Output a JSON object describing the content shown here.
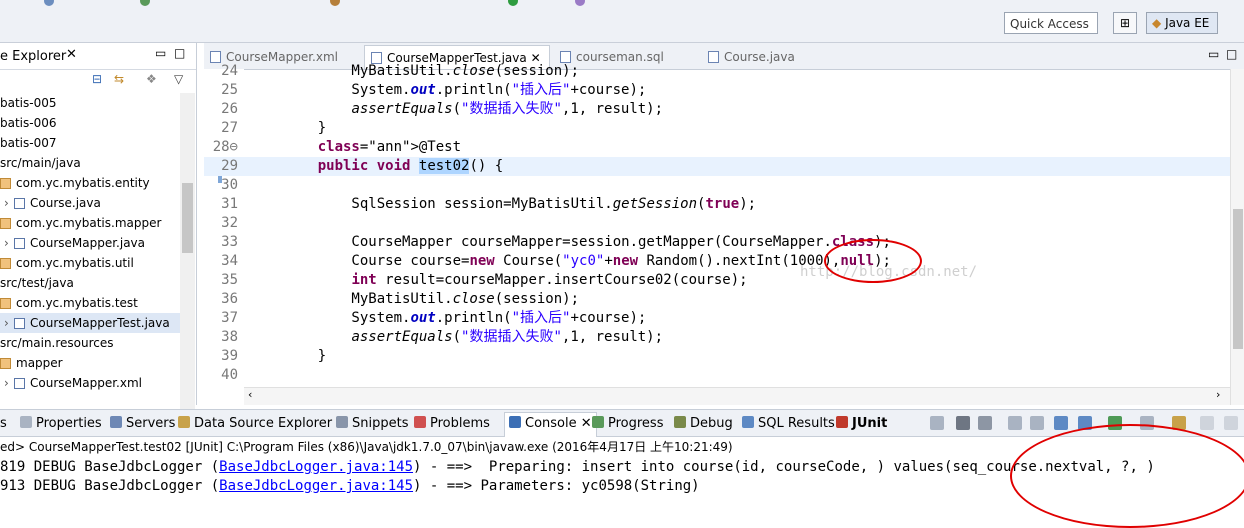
{
  "toolbar": {
    "quick_access_placeholder": "Quick Access",
    "perspective_label": "Java EE"
  },
  "explorer": {
    "title": "e Explorer",
    "items": [
      {
        "label": "batis-005",
        "type": "project"
      },
      {
        "label": "batis-006",
        "type": "project"
      },
      {
        "label": "batis-007",
        "type": "project"
      },
      {
        "label": "src/main/java",
        "type": "srcfolder"
      },
      {
        "label": "com.yc.mybatis.entity",
        "type": "package"
      },
      {
        "label": "Course.java",
        "type": "file"
      },
      {
        "label": "com.yc.mybatis.mapper",
        "type": "package"
      },
      {
        "label": "CourseMapper.java",
        "type": "file"
      },
      {
        "label": "com.yc.mybatis.util",
        "type": "package"
      },
      {
        "label": "src/test/java",
        "type": "srcfolder"
      },
      {
        "label": "com.yc.mybatis.test",
        "type": "package"
      },
      {
        "label": "CourseMapperTest.java",
        "type": "file",
        "selected": true
      },
      {
        "label": "src/main.resources",
        "type": "srcfolder"
      },
      {
        "label": "mapper",
        "type": "package"
      },
      {
        "label": "CourseMapper.xml",
        "type": "file"
      }
    ]
  },
  "editor": {
    "tabs": [
      {
        "label": "CourseMapper.xml",
        "active": false
      },
      {
        "label": "CourseMapperTest.java",
        "active": true
      },
      {
        "label": "courseman.sql",
        "active": false
      },
      {
        "label": "Course.java",
        "active": false
      }
    ],
    "watermark": "http://blog.csdn.net/",
    "lines": [
      {
        "n": "24",
        "t": "        MyBatisUtil.close(session);"
      },
      {
        "n": "25",
        "t": "        System.out.println(\"插入后\"+course);"
      },
      {
        "n": "26",
        "t": "        assertEquals(\"数据插入失败\",1, result);"
      },
      {
        "n": "27",
        "t": "    }"
      },
      {
        "n": "28⊖",
        "t": "    @Test"
      },
      {
        "n": "29",
        "t": "    public void test02() {"
      },
      {
        "n": "30",
        "t": ""
      },
      {
        "n": "31",
        "t": "        SqlSession session=MyBatisUtil.getSession(true);"
      },
      {
        "n": "32",
        "t": ""
      },
      {
        "n": "33",
        "t": "        CourseMapper courseMapper=session.getMapper(CourseMapper.class);"
      },
      {
        "n": "34",
        "t": "        Course course=new Course(\"yc0\"+new Random().nextInt(1000),null);"
      },
      {
        "n": "35",
        "t": "        int result=courseMapper.insertCourse02(course);"
      },
      {
        "n": "36",
        "t": "        MyBatisUtil.close(session);"
      },
      {
        "n": "37",
        "t": "        System.out.println(\"插入后\"+course);"
      },
      {
        "n": "38",
        "t": "        assertEquals(\"数据插入失败\",1, result);"
      },
      {
        "n": "39",
        "t": "    }"
      },
      {
        "n": "40",
        "t": ""
      }
    ]
  },
  "bottom": {
    "tabs": [
      {
        "label": "s",
        "icon": "tasks-icon"
      },
      {
        "label": "Properties",
        "icon": "properties-icon"
      },
      {
        "label": "Servers",
        "icon": "servers-icon"
      },
      {
        "label": "Data Source Explorer",
        "icon": "datasource-icon"
      },
      {
        "label": "Snippets",
        "icon": "snippets-icon"
      },
      {
        "label": "Problems",
        "icon": "problems-icon"
      },
      {
        "label": "Console",
        "icon": "console-icon",
        "active": true
      },
      {
        "label": "Progress",
        "icon": "progress-icon"
      },
      {
        "label": "Debug",
        "icon": "debug-icon"
      },
      {
        "label": "SQL Results",
        "icon": "sql-results-icon"
      },
      {
        "label": "JUnit",
        "icon": "junit-icon"
      }
    ],
    "terminated": "ed> CourseMapperTest.test02 [JUnit] C:\\Program Files (x86)\\Java\\jdk1.7.0_07\\bin\\javaw.exe (2016年4月17日 上午10:21:49)",
    "console_lines": [
      {
        "pre": "819 DEBUG BaseJdbcLogger (",
        "link": "BaseJdbcLogger.java:145",
        "post": ") - ==>  Preparing: insert into course(id, courseCode, ) values(seq_course.nextval, ?, )"
      },
      {
        "pre": "913 DEBUG BaseJdbcLogger (",
        "link": "BaseJdbcLogger.java:145",
        "post": ") - ==> Parameters: yc0598(String)"
      }
    ]
  },
  "colors": {
    "keyword": "#7f0055",
    "string": "#2a00ff",
    "annotation_circle": "#e00000",
    "link": "#0000ff"
  }
}
